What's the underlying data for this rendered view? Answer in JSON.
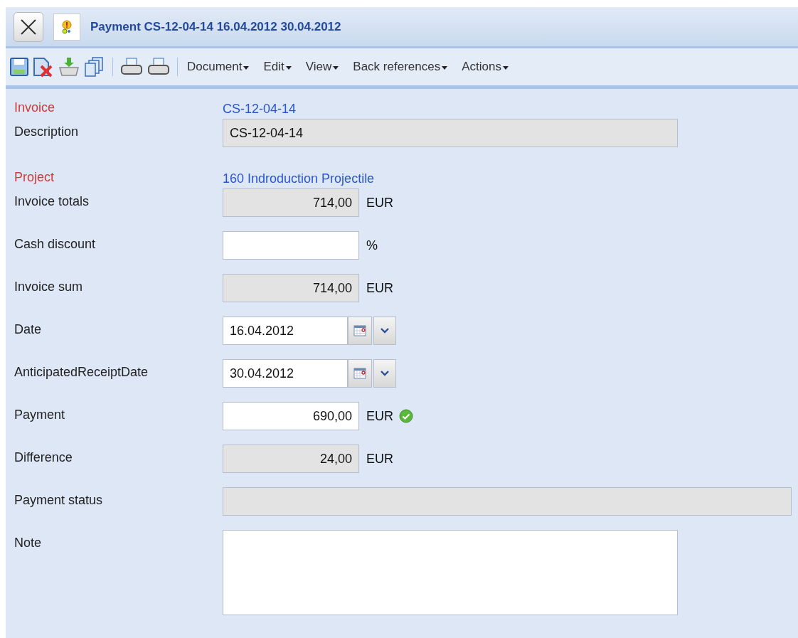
{
  "window": {
    "title": "Payment CS-12-04-14 16.04.2012 30.04.2012"
  },
  "toolbar": {
    "menus": [
      "Document",
      "Edit",
      "View",
      "Back references",
      "Actions"
    ]
  },
  "form": [
    {
      "label": "Invoice",
      "required": true,
      "kind": "link",
      "value": "CS-12-04-14"
    },
    {
      "label": "Description",
      "required": false,
      "kind": "text",
      "readonly": true,
      "value": "CS-12-04-14"
    },
    {
      "label": "Project",
      "required": true,
      "kind": "link",
      "value": "160 Indroduction Projectile"
    },
    {
      "label": "Invoice totals",
      "required": false,
      "kind": "amount",
      "readonly": true,
      "value": "714,00",
      "unit": "EUR",
      "valid": false
    },
    {
      "label": "Cash discount",
      "required": false,
      "kind": "amount",
      "readonly": false,
      "unit": "%",
      "valid": false
    },
    {
      "label": "Invoice sum",
      "required": false,
      "kind": "amount",
      "readonly": true,
      "value": "714,00",
      "unit": "EUR",
      "valid": false
    },
    {
      "label": "Date",
      "required": false,
      "kind": "date",
      "value": "16.04.2012"
    },
    {
      "label": "AnticipatedReceiptDate",
      "required": false,
      "kind": "date",
      "value": "30.04.2012"
    },
    {
      "label": "Payment",
      "required": false,
      "kind": "amount",
      "readonly": false,
      "value": "690,00",
      "unit": "EUR",
      "valid": true
    },
    {
      "label": "Difference",
      "required": false,
      "kind": "amount",
      "readonly": true,
      "value": "24,00",
      "unit": "EUR",
      "valid": false
    },
    {
      "label": "Payment status",
      "required": false,
      "kind": "full_text",
      "readonly": true
    },
    {
      "label": "Note",
      "required": false,
      "kind": "textarea"
    }
  ]
}
